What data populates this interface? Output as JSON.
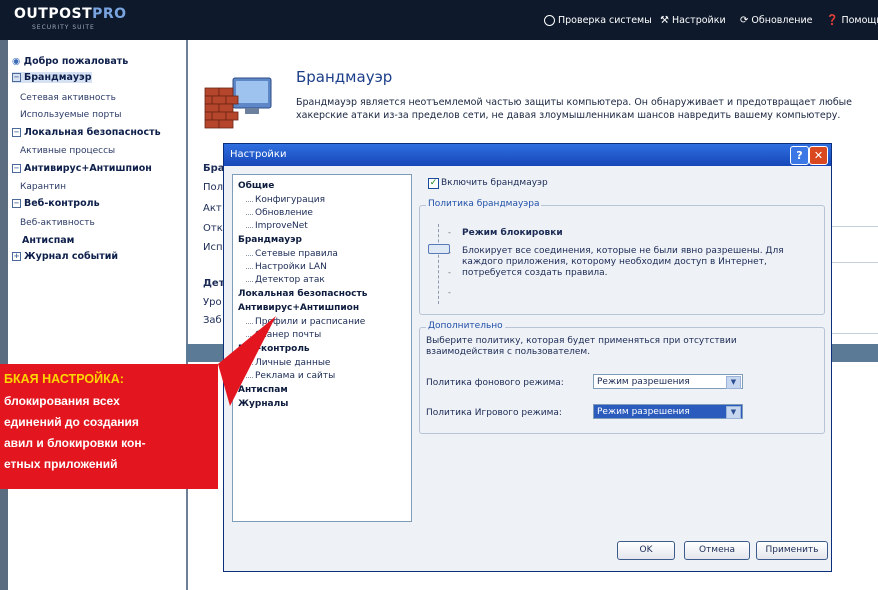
{
  "app": {
    "logo": "OUTPOST",
    "logo_pro": "PRO",
    "logo_sub": "SECURITY SUITE",
    "topnav": [
      "Проверка системы",
      "Настройки",
      "Обновление",
      "Помощь"
    ]
  },
  "leftnav": {
    "items": [
      {
        "label": "Добро пожаловать",
        "kind": "bold"
      },
      {
        "label": "Брандмауэр",
        "kind": "bold-selected"
      },
      {
        "label": "Сетевая активность",
        "kind": "sub"
      },
      {
        "label": "Используемые порты",
        "kind": "sub"
      },
      {
        "label": "Локальная безопасность",
        "kind": "bold"
      },
      {
        "label": "Активные процессы",
        "kind": "sub"
      },
      {
        "label": "Антивирус+Антишпион",
        "kind": "bold"
      },
      {
        "label": "Карантин",
        "kind": "sub"
      },
      {
        "label": "Веб-контроль",
        "kind": "bold"
      },
      {
        "label": "Веб-активность",
        "kind": "sub"
      },
      {
        "label": "Антиспам",
        "kind": "bold-plain"
      },
      {
        "label": "Журнал событий",
        "kind": "bold"
      }
    ]
  },
  "main": {
    "title": "Брандмауэр",
    "description": "Брандмауэр является неотъемлемой частью защиты компьютера. Он обнаруживает и предотвращает любые хакерские атаки из-за пределов сети, не давая злоумышленникам шансов навредить вашему компьютеру.",
    "partial_labels": [
      "Бра",
      "Пол",
      "Акт",
      "Отк",
      "Исп",
      "Дет",
      "Уро",
      "Заб"
    ]
  },
  "dialog": {
    "title": "Настройки",
    "tree": [
      {
        "label": "Общие",
        "bold": true
      },
      {
        "label": "Конфигурация"
      },
      {
        "label": "Обновление"
      },
      {
        "label": "ImproveNet"
      },
      {
        "label": "Брандмауэр",
        "bold": true
      },
      {
        "label": "Сетевые правила"
      },
      {
        "label": "Настройки LAN"
      },
      {
        "label": "Детектор атак"
      },
      {
        "label": "Локальная безопасность",
        "bold": true
      },
      {
        "label": "Антивирус+Антишпион",
        "bold": true
      },
      {
        "label": "Профили и расписание"
      },
      {
        "label": "Сканер почты"
      },
      {
        "label": "Веб-контроль",
        "bold": true
      },
      {
        "label": "Личные данные"
      },
      {
        "label": "Реклама и сайты"
      },
      {
        "label": "Антиспам",
        "bold": true
      },
      {
        "label": "Журналы",
        "bold": true
      }
    ],
    "enable_checkbox": "Включить брандмауэр",
    "policy_group": "Политика брандмауэра",
    "policy_mode": "Режим блокировки",
    "policy_desc": "Блокирует все соединения, которые не были явно разрешены. Для каждого приложения, которому необходим доступ в Интернет, потребуется создать правила.",
    "advanced_group": "Дополнительно",
    "advanced_desc": "Выберите политику, которая будет применяться при отсутствии взаимодействия с пользователем.",
    "background_label": "Политика фонового режима:",
    "background_value": "Режим разрешения",
    "game_label": "Политика Игрового режима:",
    "game_value": "Режим разрешения",
    "ok": "OK",
    "cancel": "Отмена",
    "apply": "Применить"
  },
  "callout": {
    "heading": "БКАЯ НАСТРОЙКА:",
    "lines": [
      "блокирования всех",
      "единений до создания",
      "авил и блокировки кон-",
      "етных приложений"
    ]
  }
}
